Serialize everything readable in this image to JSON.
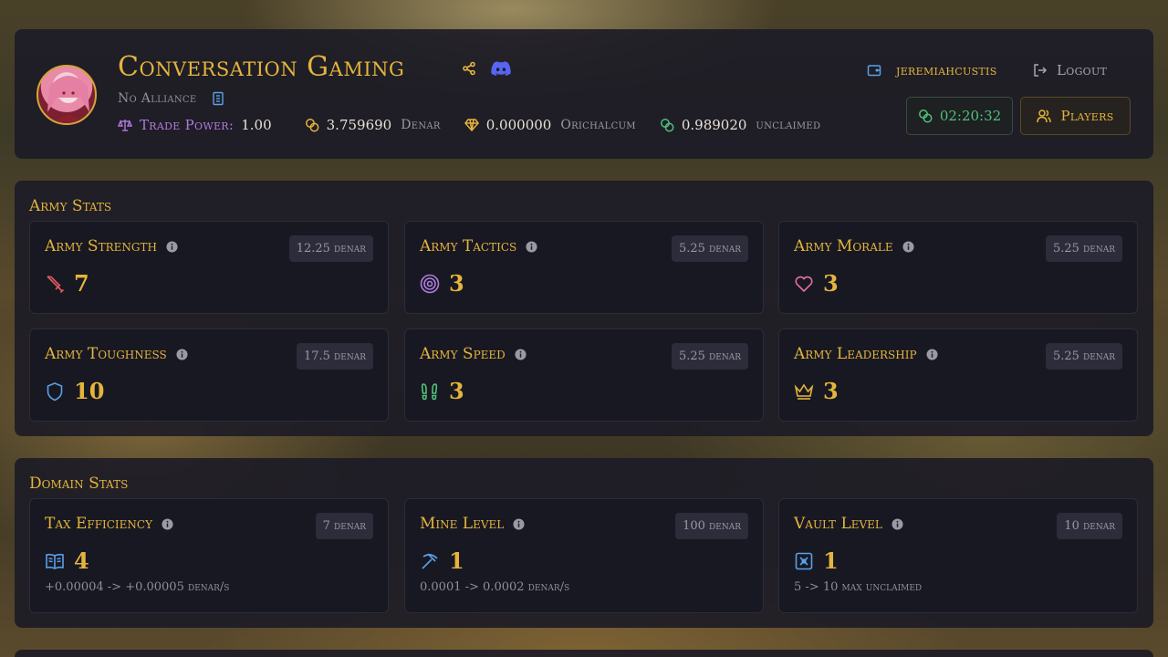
{
  "header": {
    "title": "Conversation Gaming",
    "alliance": "No Alliance",
    "trade_power_label": "Trade Power:",
    "trade_power_value": "1.00",
    "denar_value": "3.759690",
    "denar_label": "Denar",
    "orichalcum_value": "0.000000",
    "orichalcum_label": "Orichalcum",
    "unclaimed_value": "0.989020",
    "unclaimed_label": "unclaimed",
    "username": "jeremiahcustis",
    "logout_label": "Logout",
    "timer": "02:20:32",
    "players_label": "Players"
  },
  "army": {
    "section_title": "Army Stats",
    "cards": [
      {
        "name": "Army Strength",
        "cost": "12.25 denar",
        "value": "7",
        "icon": "sword-icon"
      },
      {
        "name": "Army Tactics",
        "cost": "5.25 denar",
        "value": "3",
        "icon": "target-icon"
      },
      {
        "name": "Army Morale",
        "cost": "5.25 denar",
        "value": "3",
        "icon": "heart-icon"
      },
      {
        "name": "Army Toughness",
        "cost": "17.5 denar",
        "value": "10",
        "icon": "shield-icon"
      },
      {
        "name": "Army Speed",
        "cost": "5.25 denar",
        "value": "3",
        "icon": "footprints-icon"
      },
      {
        "name": "Army Leadership",
        "cost": "5.25 denar",
        "value": "3",
        "icon": "crown-icon"
      }
    ]
  },
  "domain": {
    "section_title": "Domain Stats",
    "cards": [
      {
        "name": "Tax Efficiency",
        "cost": "7 denar",
        "value": "4",
        "note": "+0.00004 -> +0.00005 denar/s",
        "icon": "book-icon"
      },
      {
        "name": "Mine Level",
        "cost": "100 denar",
        "value": "1",
        "note": "0.0001 -> 0.0002 denar/s",
        "icon": "pickaxe-icon"
      },
      {
        "name": "Vault Level",
        "cost": "10 denar",
        "value": "1",
        "note": "5 -> 10 max unclaimed",
        "icon": "vault-icon"
      }
    ]
  },
  "colors": {
    "gold": "#e4b43c",
    "purple": "#b07be0",
    "green": "#4fc27a",
    "discord": "#5865f2",
    "blue": "#5aa0e8",
    "pink": "#e56f9f",
    "red": "#e05a5a"
  }
}
